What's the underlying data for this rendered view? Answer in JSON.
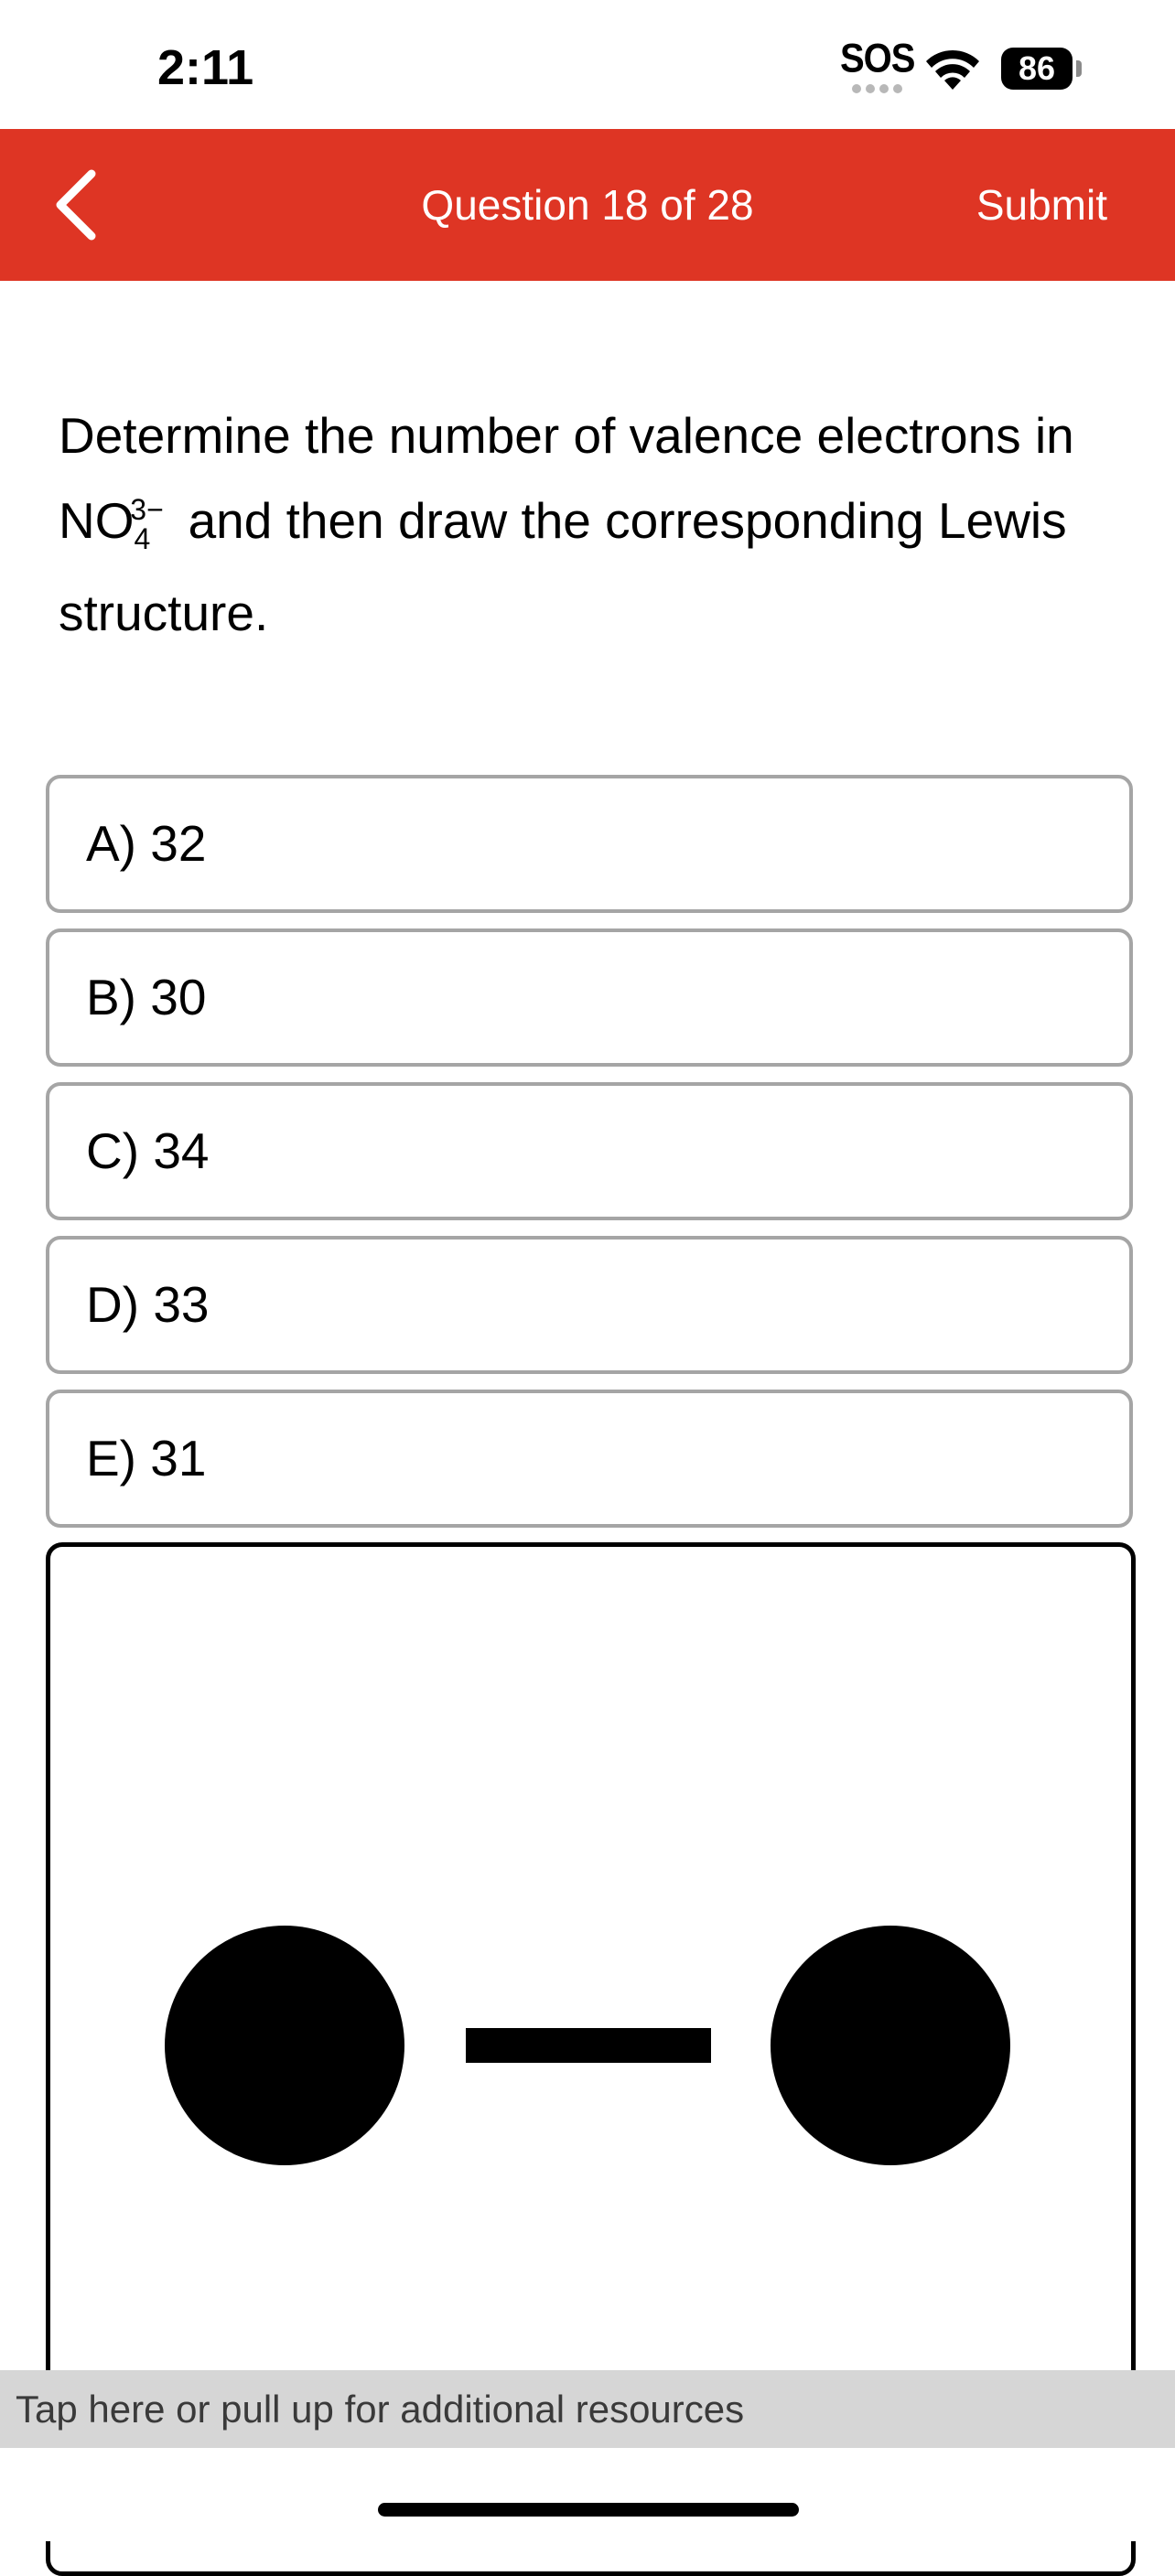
{
  "status_bar": {
    "time": "2:11",
    "sos": "SOS",
    "battery": "86"
  },
  "nav": {
    "title": "Question 18 of 28",
    "submit_label": "Submit",
    "accent_color": "#de3524"
  },
  "question": {
    "text_before": "Determine the number of valence electrons in ",
    "formula_main": "NO",
    "formula_subscript": "4",
    "formula_superscript": "3−",
    "text_after": " and then draw the corresponding Lewis structure."
  },
  "options": [
    {
      "label": "A) 32"
    },
    {
      "label": "B) 30"
    },
    {
      "label": "C) 34"
    },
    {
      "label": "D) 33"
    },
    {
      "label": "E) 31"
    }
  ],
  "resources": {
    "label": "Tap here or pull up for additional resources"
  },
  "icons": {
    "back": "chevron-left-icon",
    "wifi": "wifi-icon",
    "battery": "battery-icon"
  }
}
